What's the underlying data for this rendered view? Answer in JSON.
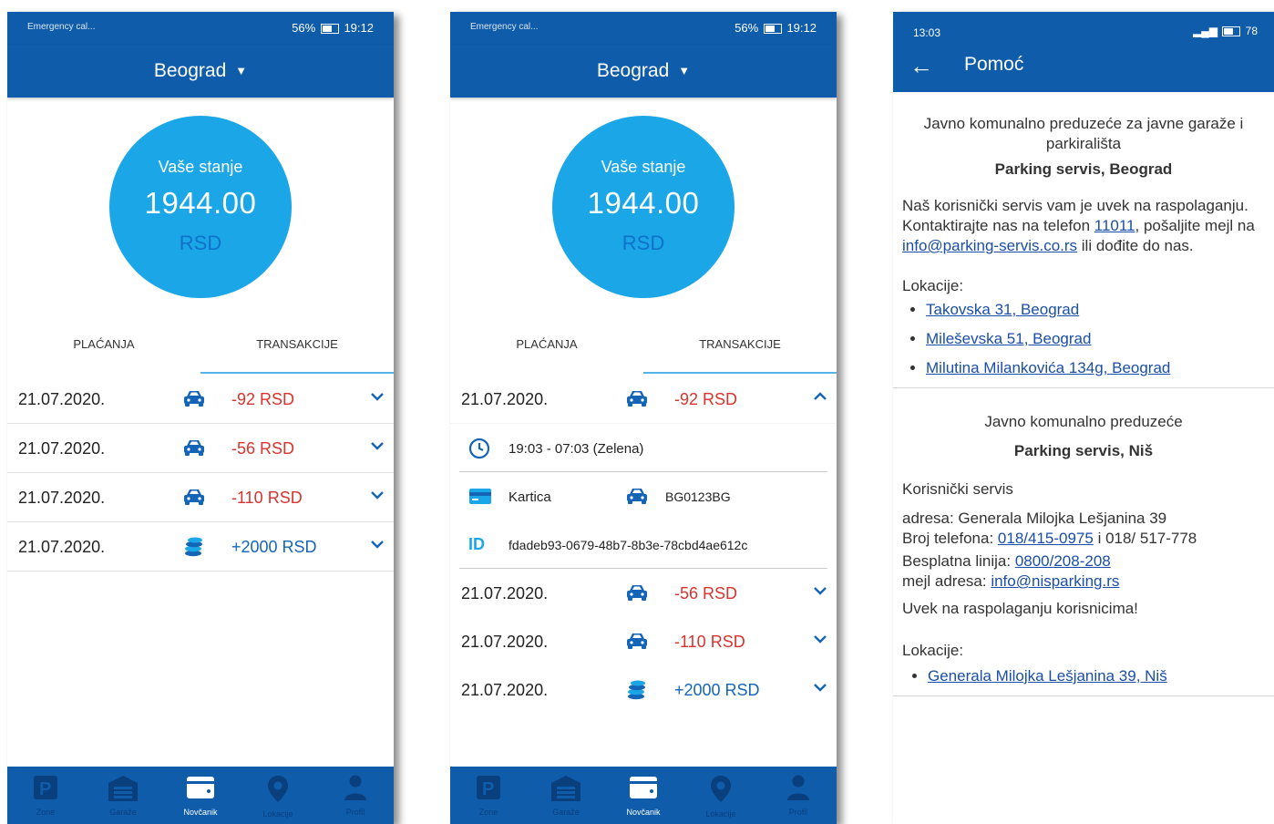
{
  "phone1": {
    "status": {
      "left": "Emergency cal...",
      "battery": "56%",
      "time": "19:12"
    },
    "city": "Beograd",
    "balance": {
      "label": "Vaše stanje",
      "amount": "1944.00",
      "currency": "RSD"
    },
    "tabs": [
      "PLAĆANJA",
      "TRANSAKCIJE"
    ],
    "transactions": [
      {
        "date": "21.07.2020.",
        "icon": "car-icon",
        "amount": "-92 RSD",
        "type": "neg"
      },
      {
        "date": "21.07.2020.",
        "icon": "car-icon",
        "amount": "-56 RSD",
        "type": "neg"
      },
      {
        "date": "21.07.2020.",
        "icon": "coins-icon",
        "amount": "-110 RSD",
        "type": "neg"
      },
      {
        "date": "21.07.2020.",
        "icon": "coins-icon",
        "amount": "+2000 RSD",
        "type": "pos"
      }
    ],
    "nav": [
      "Zone",
      "Garaže",
      "Novčanik",
      "Lokacije",
      "Profil"
    ]
  },
  "phone2": {
    "status": {
      "left": "Emergency cal...",
      "battery": "56%",
      "time": "19:12"
    },
    "city": "Beograd",
    "balance": {
      "label": "Vaše stanje",
      "amount": "1944.00",
      "currency": "RSD"
    },
    "tabs": [
      "PLAĆANJA",
      "TRANSAKCIJE"
    ],
    "expanded": {
      "date": "21.07.2020.",
      "amount": "-92 RSD"
    },
    "details": {
      "time": "19:03 - 07:03 (Zelena)",
      "payment": "Kartica",
      "plate": "BG0123BG",
      "id_label": "ID",
      "id": "fdadeb93-0679-48b7-8b3e-78cbd4ae612c"
    },
    "transactions": [
      {
        "date": "21.07.2020.",
        "amount": "-56 RSD"
      },
      {
        "date": "21.07.2020.",
        "amount": "-110 RSD"
      },
      {
        "date": "21.07.2020.",
        "amount": "+2000 RSD"
      }
    ],
    "nav": [
      "Zone",
      "Garaže",
      "Novčanik",
      "Lokacije",
      "Profil"
    ]
  },
  "phone3": {
    "status": {
      "time": "13:03",
      "battery": "78"
    },
    "title": "Pomoć",
    "bg": {
      "org": "Javno komunalno preduzeće za javne garaže i parkirališta",
      "name": "Parking servis, Beograd",
      "text1": "Naš korisnički servis vam je uvek na raspolaganju. Kontaktirajte nas na telefon ",
      "phone": "11011",
      "text2": ", pošaljite mejl na ",
      "email": "info@parking-servis.co.rs",
      "text3": " ili dođite do nas.",
      "loc_label": "Lokacije:",
      "locations": [
        "Takovska 31, Beograd",
        "Mileševska 51, Beograd",
        "Milutina Milankovića 134g, Beograd"
      ]
    },
    "nis": {
      "org": "Javno komunalno preduzeće",
      "name": "Parking servis, Niš",
      "service": "Korisnički servis",
      "addr": "adresa: Generala Milojka Lešjanina 39",
      "phone_label": "Broj telefona: ",
      "phone": "018/415-0975",
      "phone_extra": " i 018/ 517-778",
      "free_label": "Besplatna linija: ",
      "free": "0800/208-208",
      "mail_label": "mejl adresa: ",
      "mail": "info@nisparking.rs",
      "always": "Uvek na raspolaganju korisnicima!",
      "loc_label": "Lokacije:",
      "location": "Generala Milojka Lešjanina 39, Niš"
    }
  }
}
